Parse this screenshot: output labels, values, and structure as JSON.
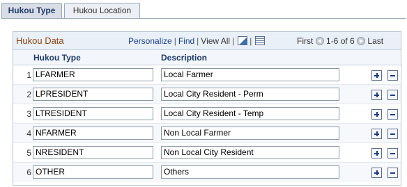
{
  "tabs": [
    {
      "label": "Hukou Type",
      "active": true
    },
    {
      "label": "Hukou Location",
      "active": false
    }
  ],
  "grid": {
    "title": "Hukou Data",
    "toolbar": {
      "personalize": "Personalize",
      "find": "Find",
      "view_all": "View All",
      "zoom_icon": "zoom-grid-icon",
      "download_icon": "spreadsheet-download-icon"
    },
    "pager": {
      "first": "First",
      "range": "1-6 of 6",
      "last": "Last"
    },
    "columns": {
      "code": "Hukou Type",
      "description": "Description"
    },
    "rows": [
      {
        "num": "1",
        "code": "LFARMER",
        "description": "Local Farmer"
      },
      {
        "num": "2",
        "code": "LPRESIDENT",
        "description": "Local City Resident - Perm"
      },
      {
        "num": "3",
        "code": "LTRESIDENT",
        "description": "Local City Resident - Temp"
      },
      {
        "num": "4",
        "code": "NFARMER",
        "description": "Non Local Farmer"
      },
      {
        "num": "5",
        "code": "NRESIDENT",
        "description": "Non Local City Resident"
      },
      {
        "num": "6",
        "code": "OTHER",
        "description": "Others"
      }
    ]
  },
  "colors": {
    "title": "#8b4513",
    "link": "#1a3f8b",
    "header_bg": "#eaf0f8"
  }
}
